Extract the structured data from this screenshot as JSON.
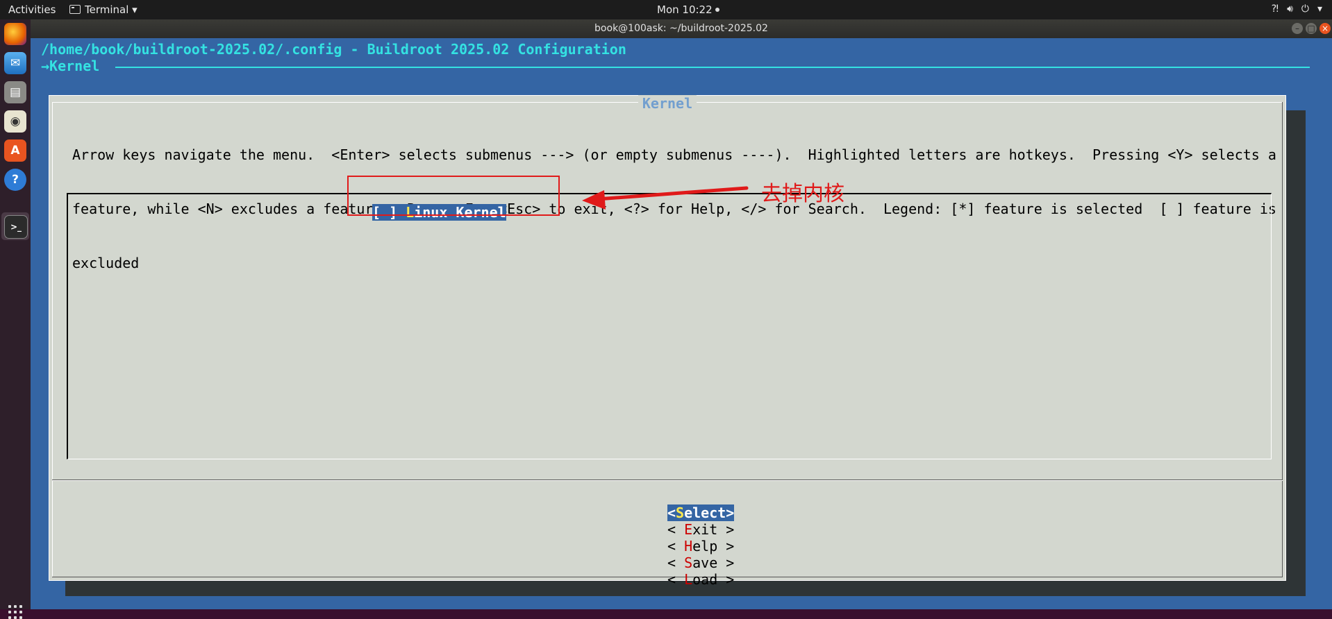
{
  "topbar": {
    "activities": "Activities",
    "app_menu": "Terminal ▾",
    "clock": "Mon 10:22",
    "sys_icons": [
      "network-icon",
      "volume-icon",
      "power-icon",
      "dropdown-icon"
    ]
  },
  "dock": {
    "apps": [
      "firefox-icon",
      "thunderbird-icon",
      "files-icon",
      "rhythmbox-icon",
      "software-center-icon",
      "help-icon",
      "terminal-icon"
    ]
  },
  "window": {
    "title": "book@100ask: ~/buildroot-2025.02"
  },
  "terminal": {
    "config_path": "/home/book/buildroot-2025.02/.config - Buildroot 2025.02 Configuration",
    "breadcrumb": "→Kernel"
  },
  "dialog": {
    "title": "Kernel",
    "help_lines": [
      "Arrow keys navigate the menu.  <Enter> selects submenus ---> (or empty submenus ----).  Highlighted letters are hotkeys.  Pressing <Y> selects a",
      "feature, while <N> excludes a feature.  Press <Esc><Esc> to exit, <?> for Help, </> for Search.  Legend: [*] feature is selected  [ ] feature is",
      "excluded"
    ],
    "menu_item": {
      "checkbox": "[ ]",
      "hotkey": "L",
      "rest": "inux Kernel",
      "selected": false
    },
    "buttons": [
      {
        "pre": "<",
        "hot": "S",
        "rest": "elect",
        "post": ">",
        "selected": true
      },
      {
        "pre": "< ",
        "hot": "E",
        "rest": "xit",
        "post": " >",
        "selected": false
      },
      {
        "pre": "< ",
        "hot": "H",
        "rest": "elp",
        "post": " >",
        "selected": false
      },
      {
        "pre": "< ",
        "hot": "S",
        "rest": "ave",
        "post": " >",
        "selected": false
      },
      {
        "pre": "< ",
        "hot": "L",
        "rest": "oad",
        "post": " >",
        "selected": false
      }
    ]
  },
  "annotation": {
    "label": "去掉内核",
    "color": "#e01a1a"
  },
  "colors": {
    "terminal_bg": "#3465a4",
    "dialog_bg": "#d3d7cf",
    "title_cyan": "#34e2e2",
    "hotkey_yellow": "#fce94f",
    "hotkey_red": "#cc0000"
  }
}
